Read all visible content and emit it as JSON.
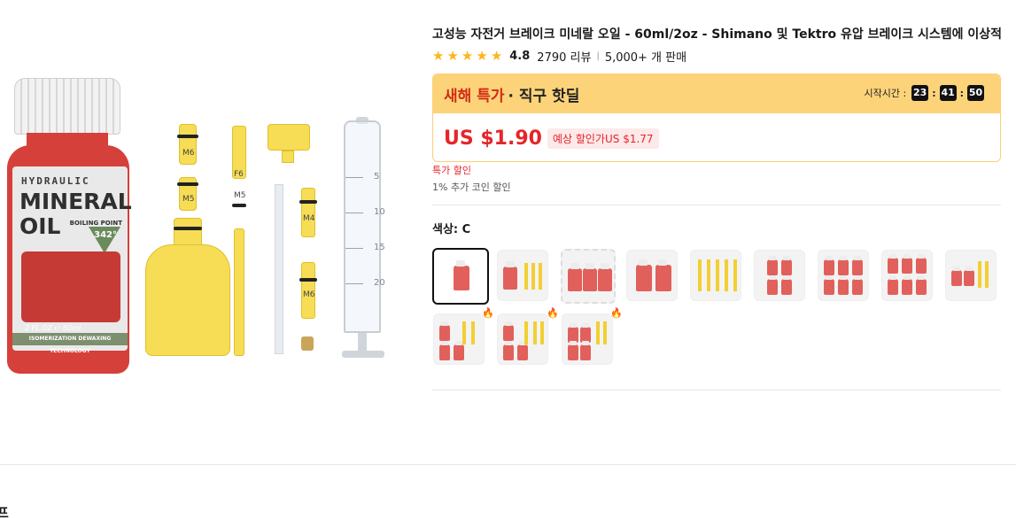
{
  "product": {
    "title": "고성능 자전거 브레이크 미네랄 오일 - 60ml/2oz - Shimano 및 Tektro 유압 브레이크 시스템에 이상적",
    "rating": {
      "score": "4.8",
      "reviews": "2790 리뷰",
      "sales": "5,000+ 개 판매",
      "stars": 5
    },
    "deal": {
      "promo_title": "새해 특가",
      "promo_sub": "· 직구 핫딜",
      "timer_label": "시작시간 :",
      "timer": {
        "hours": "23",
        "minutes": "41",
        "seconds": "50"
      },
      "price": "US $1.90",
      "estimated": "예상 할인가US $1.77"
    },
    "sale_text": "특가 할인",
    "coin_text": "1% 추가 코인 할인",
    "color_label": "색상: C"
  },
  "image_text": {
    "hydraulic": "HYDRAULIC",
    "mineral": "MINERAL",
    "oil": "OIL",
    "boiling_point": "BOILING POINT",
    "degree": "342°",
    "volume": "2 FL.OZ ℮ 60ml",
    "band": "ISOMERIZATION DEWAXING TECHNOLOGY",
    "m6": "M6",
    "m5": "M5",
    "m4": "M4",
    "m6b": "M6",
    "m5b": "M5",
    "f6": "F6",
    "syringe_marks": [
      "5",
      "10",
      "15",
      "20"
    ]
  },
  "icons": {
    "star": "star-icon",
    "fire": "fire-icon"
  },
  "colors": {
    "accent_red": "#e5252a",
    "deal_bg": "#fdd37a",
    "star": "#fdb61a"
  },
  "bottom": {
    "cut_heading": "프"
  }
}
